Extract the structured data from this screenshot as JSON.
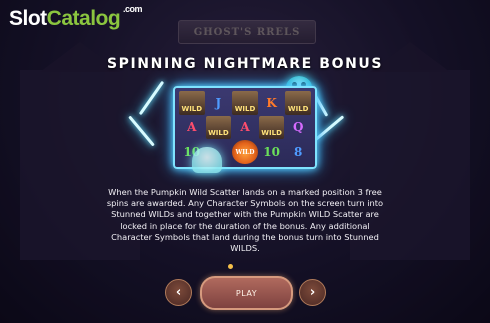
{
  "logo": {
    "part1": "Slot",
    "part2": "Catalog",
    "suffix": ".com"
  },
  "background_sign": "GHOST'S   RRELS",
  "title": "SPINNING NIGHTMARE BONUS",
  "reels": [
    [
      "",
      "J",
      "",
      "K",
      ""
    ],
    [
      "A",
      "",
      "A",
      "",
      "Q"
    ],
    [
      "10",
      "",
      "",
      "10",
      "8"
    ]
  ],
  "wild_label": "WILD",
  "description": "When the Pumpkin Wild Scatter lands on a marked position 3 free spins are awarded. Any Character Symbols on the screen turn into Stunned WILDs and together with the Pumpkin WILD Scatter are locked in place for the duration of the bonus. Any additional Character Symbols that land during the bonus turn into Stunned WILDS.",
  "buttons": {
    "prev": "‹",
    "play": "PLAY",
    "next": "›"
  },
  "colors": {
    "logo_accent": "#8bc53f",
    "lightning": "#6ee8ff",
    "dot": "#f5c04a"
  }
}
